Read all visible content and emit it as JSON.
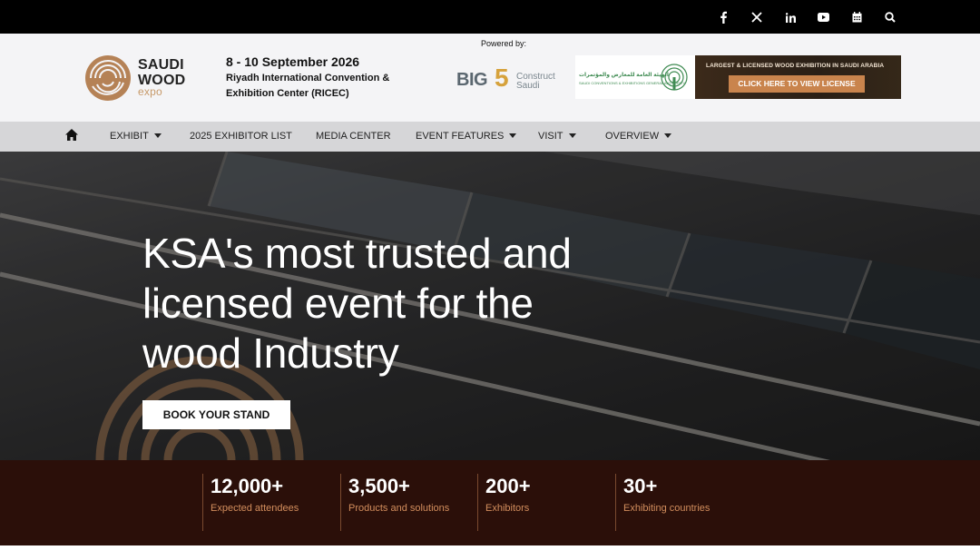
{
  "social_icons": [
    "facebook-icon",
    "x-icon",
    "linkedin-icon",
    "youtube-icon",
    "calendar-icon",
    "search-icon"
  ],
  "header": {
    "logo": {
      "line1": "SAUDI",
      "line2": "WOOD",
      "line3": "expo"
    },
    "event_date": "8 - 10 September 2026",
    "venue": "Riyadh International Convention & Exhibition Center (RICEC)",
    "powered_by": "Powered by:",
    "big5": {
      "big": "BIG",
      "five": "5",
      "construct": "Construct",
      "saudi": "Saudi"
    },
    "license_banner": {
      "authority_ar": "الهيئة العامة للمعارض والمؤتمرات",
      "authority_en": "SAUDI CONVENTIONS & EXHIBITIONS GENERAL AUTHORITY",
      "headline": "LARGEST & LICENSED WOOD EXHIBITION IN SAUDI ARABIA",
      "button": "CLICK HERE TO VIEW LICENSE"
    }
  },
  "nav": {
    "items": [
      {
        "label": "EXHIBIT",
        "dropdown": true
      },
      {
        "label": "2025 EXHIBITOR LIST",
        "dropdown": false
      },
      {
        "label": "MEDIA CENTER",
        "dropdown": false
      },
      {
        "label": "EVENT FEATURES",
        "dropdown": true
      },
      {
        "label": "VISIT",
        "dropdown": true
      },
      {
        "label": "OVERVIEW",
        "dropdown": true
      }
    ]
  },
  "hero": {
    "title": "KSA's most trusted and licensed event for the wood Industry",
    "button": "BOOK YOUR STAND"
  },
  "stats": [
    {
      "value": "12,000+",
      "label": "Expected attendees"
    },
    {
      "value": "3,500+",
      "label": "Products and solutions"
    },
    {
      "value": "200+",
      "label": "Exhibitors"
    },
    {
      "value": "30+",
      "label": "Exhibiting countries"
    }
  ],
  "colors": {
    "topbar": "#000000",
    "header_bg": "#f4f4f6",
    "nav_bg": "#d6d6d8",
    "stats_bg": "#2b0f09",
    "stat_label": "#d38e5d",
    "accent_copper": "#c9844d"
  }
}
